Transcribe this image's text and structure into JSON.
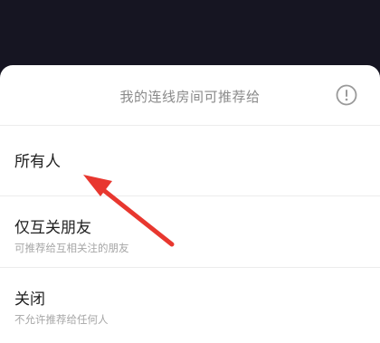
{
  "sheet": {
    "title": "我的连线房间可推荐给",
    "info_icon": "info-circle-icon"
  },
  "options": [
    {
      "label": "所有人",
      "description": ""
    },
    {
      "label": "仅互关朋友",
      "description": "可推荐给互相关注的朋友"
    },
    {
      "label": "关闭",
      "description": "不允许推荐给任何人"
    }
  ],
  "annotation": {
    "icon": "red-arrow-icon",
    "color": "#e8372f"
  }
}
